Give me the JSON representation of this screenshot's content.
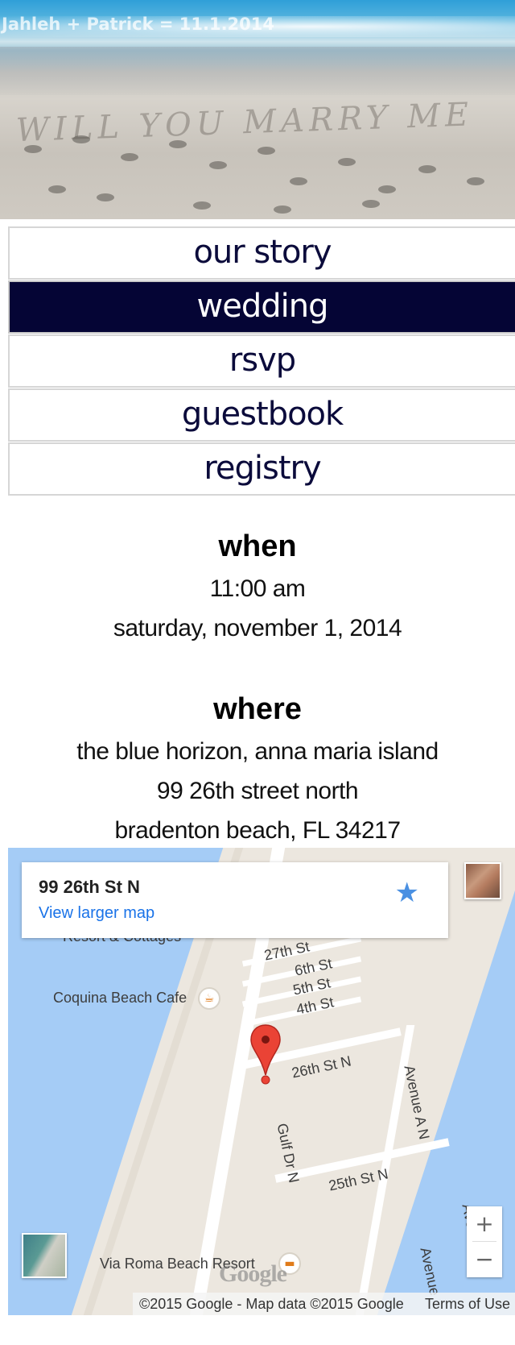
{
  "hero": {
    "caption": "Jahleh + Patrick = 11.1.2014",
    "sand_writing": "WILL YOU MARRY ME"
  },
  "nav": {
    "items": [
      {
        "label": "our story",
        "active": false
      },
      {
        "label": "wedding",
        "active": true
      },
      {
        "label": "rsvp",
        "active": false
      },
      {
        "label": "guestbook",
        "active": false
      },
      {
        "label": "registry",
        "active": false
      }
    ]
  },
  "when": {
    "title": "when",
    "time": "11:00 am",
    "date": "saturday, november 1, 2014"
  },
  "where": {
    "title": "where",
    "venue": "the blue horizon, anna maria island",
    "street": "99 26th street north",
    "city": "bradenton beach, FL 34217"
  },
  "map": {
    "card_title": "99 26th St N",
    "card_link": "View larger map",
    "labels": {
      "resort_cottages": "Resort & Cottages",
      "coquina": "Coquina Beach Cafe",
      "via_roma": "Via Roma Beach Resort",
      "st27": "27th St",
      "st6": "6th St",
      "st5": "5th St",
      "st4": "4th St",
      "st26": "26th St N",
      "st25": "25th St N",
      "gulf": "Gulf Dr N",
      "avenue_a": "Avenue A N",
      "avenue_a2": "Avenue A",
      "avenue_b": "Avenue"
    },
    "zoom_in": "+",
    "zoom_out": "−",
    "logo": "Google",
    "attribution": "©2015 Google - Map data ©2015 Google",
    "terms": "Terms of Use",
    "colors": {
      "water": "#a5ccf6",
      "land": "#ece7df",
      "pin": "#ea4335",
      "link": "#1a73e8",
      "nav_active": "#050535"
    }
  }
}
